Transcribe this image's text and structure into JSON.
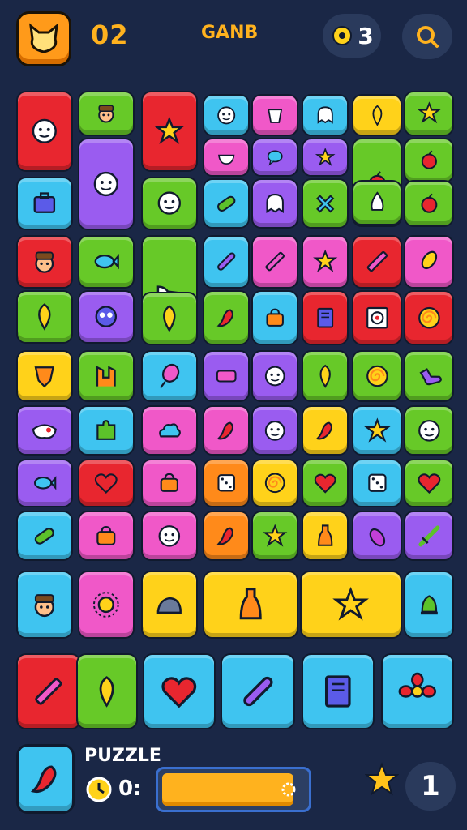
{
  "header": {
    "level": "02",
    "title": "GANB",
    "hint_count": "3"
  },
  "colors": {
    "red": "#e8262f",
    "green": "#67c928",
    "purple": "#9a5cf0",
    "blue": "#3fc4f0",
    "pink": "#f058c8",
    "yellow": "#ffd21a",
    "orange": "#ff8a1a",
    "dark": "#101a2e",
    "accent": "#ffb21e"
  },
  "tiles": [
    {
      "color": "red",
      "icon": "face-icon"
    },
    {
      "color": "green",
      "icon": "hat-face-icon"
    },
    {
      "color": "red",
      "icon": "star-icon"
    },
    {
      "color": "blue",
      "icon": "face-icon"
    },
    {
      "color": "pink",
      "icon": "cup-icon"
    },
    {
      "color": "blue",
      "icon": "ghost-icon"
    },
    {
      "color": "yellow",
      "icon": "leaf-icon"
    },
    {
      "color": "green",
      "icon": "star-icon"
    },
    {
      "color": "blue",
      "icon": "briefcase-icon"
    },
    {
      "color": "purple",
      "icon": "face-icon"
    },
    {
      "color": "green",
      "icon": "face-icon"
    },
    {
      "color": "pink",
      "icon": "bowl-icon"
    },
    {
      "color": "purple",
      "icon": "chat-icon"
    },
    {
      "color": "purple",
      "icon": "star-icon"
    },
    {
      "color": "green",
      "icon": "berry-icon"
    },
    {
      "color": "green",
      "icon": "berry-icon"
    },
    {
      "color": "blue",
      "icon": "pickle-icon"
    },
    {
      "color": "purple",
      "icon": "ghost-icon"
    },
    {
      "color": "green",
      "icon": "cross-icon"
    },
    {
      "color": "green",
      "icon": "garlic-icon"
    },
    {
      "color": "green",
      "icon": "berry-icon"
    },
    {
      "color": "red",
      "icon": "hat-face-icon"
    },
    {
      "color": "green",
      "icon": "fish-icon"
    },
    {
      "color": "green",
      "icon": "shoe-icon"
    },
    {
      "color": "blue",
      "icon": "pen-icon"
    },
    {
      "color": "pink",
      "icon": "pencil-icon"
    },
    {
      "color": "pink",
      "icon": "star-icon"
    },
    {
      "color": "red",
      "icon": "pencil-icon"
    },
    {
      "color": "pink",
      "icon": "corn-icon"
    },
    {
      "color": "green",
      "icon": "leaf-icon"
    },
    {
      "color": "purple",
      "icon": "owl-icon"
    },
    {
      "color": "green",
      "icon": "leaf-icon"
    },
    {
      "color": "green",
      "icon": "pepper-icon"
    },
    {
      "color": "blue",
      "icon": "bag-icon"
    },
    {
      "color": "red",
      "icon": "book-icon"
    },
    {
      "color": "red",
      "icon": "target-icon"
    },
    {
      "color": "red",
      "icon": "spiral-icon"
    },
    {
      "color": "yellow",
      "icon": "shield-icon"
    },
    {
      "color": "green",
      "icon": "chair-icon"
    },
    {
      "color": "blue",
      "icon": "balloon-icon"
    },
    {
      "color": "purple",
      "icon": "bar-icon"
    },
    {
      "color": "purple",
      "icon": "face-icon"
    },
    {
      "color": "green",
      "icon": "leaf-icon"
    },
    {
      "color": "green",
      "icon": "spiral-icon"
    },
    {
      "color": "green",
      "icon": "sock-icon"
    },
    {
      "color": "purple",
      "icon": "mask-icon"
    },
    {
      "color": "blue",
      "icon": "puzzle-icon"
    },
    {
      "color": "pink",
      "icon": "cloud-icon"
    },
    {
      "color": "pink",
      "icon": "pepper-icon"
    },
    {
      "color": "purple",
      "icon": "face-icon"
    },
    {
      "color": "yellow",
      "icon": "pepper-icon"
    },
    {
      "color": "blue",
      "icon": "star-icon"
    },
    {
      "color": "green",
      "icon": "face-icon"
    },
    {
      "color": "purple",
      "icon": "fish-icon"
    },
    {
      "color": "red",
      "icon": "heart-icon"
    },
    {
      "color": "pink",
      "icon": "bag-icon"
    },
    {
      "color": "orange",
      "icon": "dice-icon"
    },
    {
      "color": "yellow",
      "icon": "spiral-icon"
    },
    {
      "color": "green",
      "icon": "heart-icon"
    },
    {
      "color": "blue",
      "icon": "dice-icon"
    },
    {
      "color": "green",
      "icon": "heart-icon"
    },
    {
      "color": "blue",
      "icon": "pickle-icon"
    },
    {
      "color": "pink",
      "icon": "bag-icon"
    },
    {
      "color": "pink",
      "icon": "face-icon"
    },
    {
      "color": "orange",
      "icon": "pepper-icon"
    },
    {
      "color": "green",
      "icon": "star-icon"
    },
    {
      "color": "yellow",
      "icon": "bottle-icon"
    },
    {
      "color": "purple",
      "icon": "eggplant-icon"
    },
    {
      "color": "purple",
      "icon": "sword-icon"
    },
    {
      "color": "blue",
      "icon": "hat-face-icon"
    },
    {
      "color": "pink",
      "icon": "sun-icon"
    },
    {
      "color": "yellow",
      "icon": "stone-icon"
    },
    {
      "color": "yellow",
      "icon": "bottle-icon"
    },
    {
      "color": "yellow",
      "icon": "star-icon"
    },
    {
      "color": "blue",
      "icon": "bell-icon"
    },
    {
      "color": "red",
      "icon": "pencil-icon"
    },
    {
      "color": "green",
      "icon": "leaf-icon"
    },
    {
      "color": "blue",
      "icon": "heart-icon"
    },
    {
      "color": "blue",
      "icon": "pen-icon"
    },
    {
      "color": "blue",
      "icon": "book-icon"
    },
    {
      "color": "blue",
      "icon": "flower-icon"
    }
  ],
  "footer": {
    "current_tile": {
      "color": "blue",
      "icon": "pepper-icon"
    },
    "label": "PUZZLE",
    "timer": "0:",
    "progress": 0.92,
    "score": "1"
  }
}
